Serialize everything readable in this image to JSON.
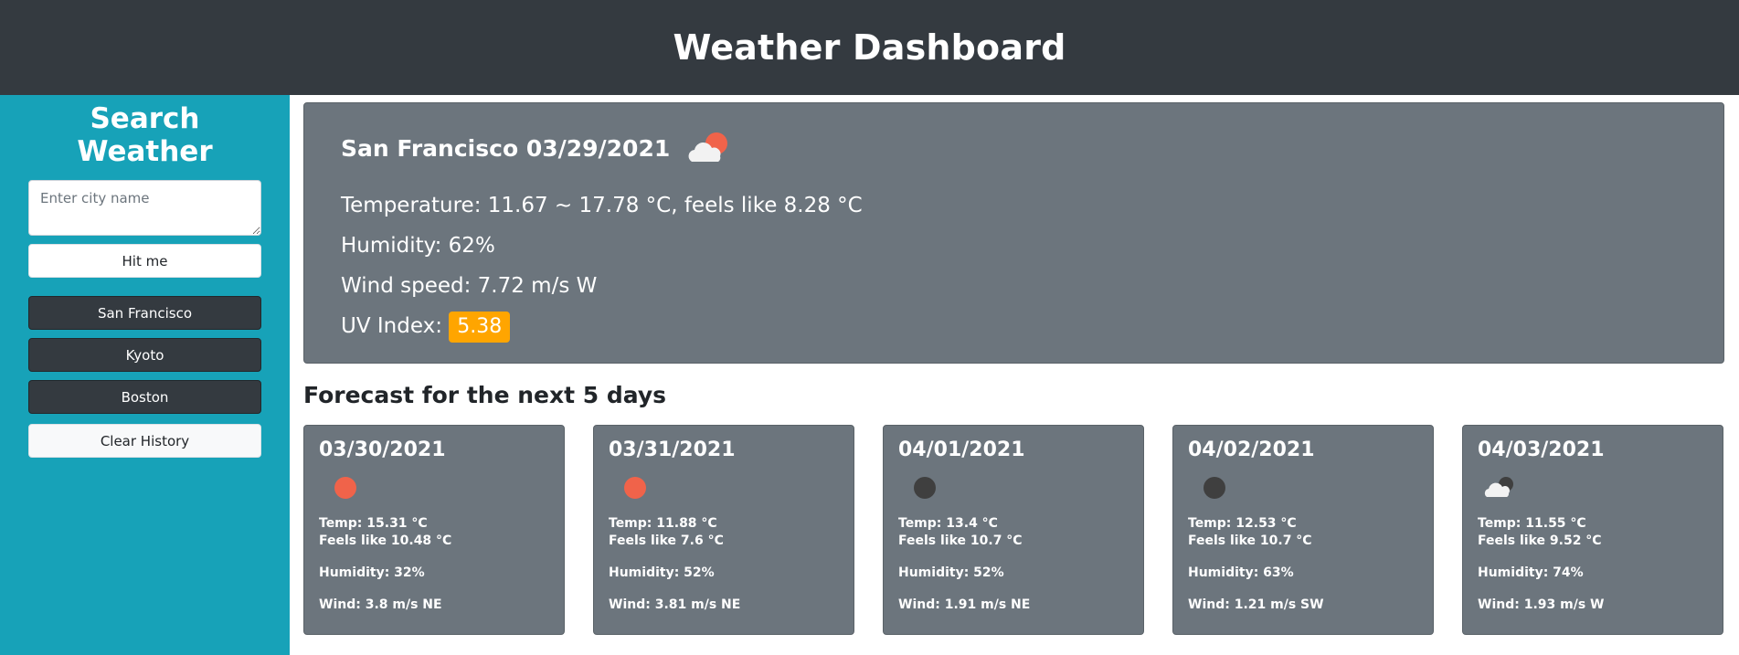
{
  "header": {
    "title": "Weather Dashboard"
  },
  "sidebar": {
    "title": "Search Weather",
    "search_placeholder": "Enter city name",
    "search_value": "",
    "submit_label": "Hit me",
    "history": [
      {
        "label": "San Francisco"
      },
      {
        "label": "Kyoto"
      },
      {
        "label": "Boston"
      }
    ],
    "clear_label": "Clear History"
  },
  "current": {
    "title": "San Francisco 03/29/2021",
    "icon": "sun-behind-cloud-icon",
    "temperature": "Temperature: 11.67 ~ 17.78 °C, feels like 8.28 °C",
    "humidity": "Humidity: 62%",
    "wind": "Wind speed: 7.72 m/s W",
    "uv_label": "UV Index: ",
    "uv_value": "5.38",
    "uv_color": "#ffa500"
  },
  "forecast": {
    "title": "Forecast for the next 5 days",
    "days": [
      {
        "date": "03/30/2021",
        "icon": "sun-icon",
        "temp": "Temp: 15.31 °C",
        "feels": "Feels like 10.48 °C",
        "humidity": "Humidity: 32%",
        "wind": "Wind: 3.8 m/s NE"
      },
      {
        "date": "03/31/2021",
        "icon": "sun-icon",
        "temp": "Temp: 11.88 °C",
        "feels": "Feels like 7.6 °C",
        "humidity": "Humidity: 52%",
        "wind": "Wind: 3.81 m/s NE"
      },
      {
        "date": "04/01/2021",
        "icon": "moon-icon",
        "temp": "Temp: 13.4 °C",
        "feels": "Feels like 10.7 °C",
        "humidity": "Humidity: 52%",
        "wind": "Wind: 1.91 m/s NE"
      },
      {
        "date": "04/02/2021",
        "icon": "moon-icon",
        "temp": "Temp: 12.53 °C",
        "feels": "Feels like 10.7 °C",
        "humidity": "Humidity: 63%",
        "wind": "Wind: 1.21 m/s SW"
      },
      {
        "date": "04/03/2021",
        "icon": "moon-behind-cloud-icon",
        "temp": "Temp: 11.55 °C",
        "feels": "Feels like 9.52 °C",
        "humidity": "Humidity: 74%",
        "wind": "Wind: 1.93 m/s W"
      }
    ]
  },
  "colors": {
    "header_bg": "#343a40",
    "sidebar_bg": "#17a2b8",
    "card_bg": "#6c757d",
    "sun": "#f0634a",
    "moon": "#3f3f3f",
    "cloud": "#f2f2f2"
  }
}
